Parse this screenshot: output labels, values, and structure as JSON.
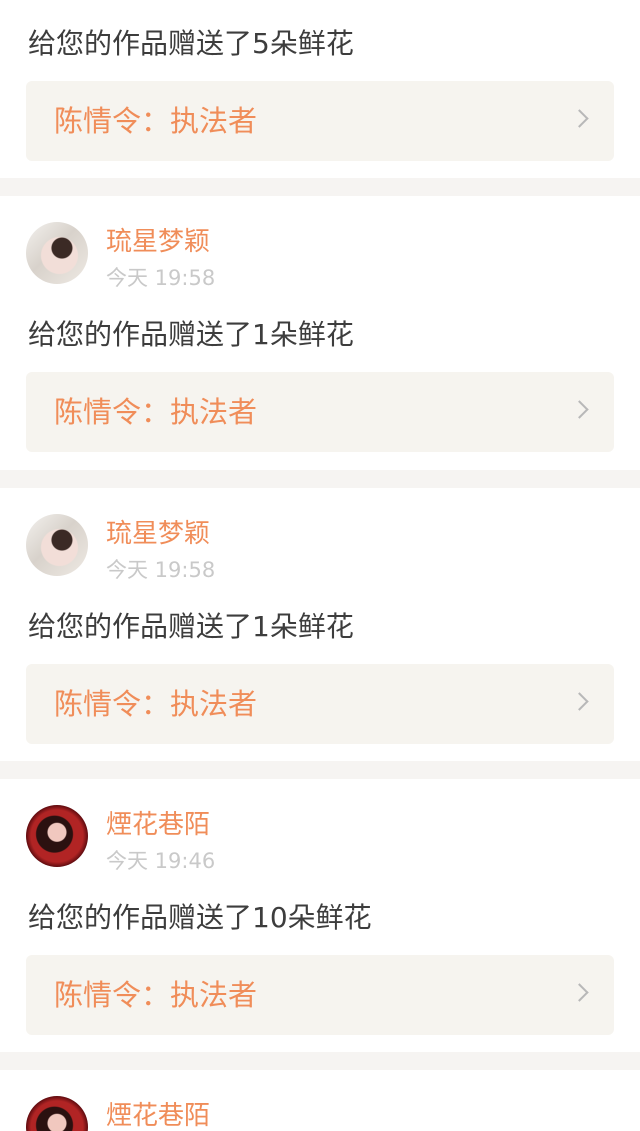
{
  "colors": {
    "accent": "#f08d59",
    "tab_indicator": "#e96a8f",
    "message_text": "#3d3d3d",
    "timestamp": "#c9c9c9",
    "card_link_bg": "#f6f4ef",
    "separator": "#f6f4f2"
  },
  "notifications": [
    {
      "username": "",
      "time": "",
      "message": "给您的作品赠送了5朵鲜花",
      "work_title": "陈情令：执法者",
      "chevron_icon": "chevron-right-icon"
    },
    {
      "username": "琉星梦颖",
      "time": "今天 19:58",
      "message": "给您的作品赠送了1朵鲜花",
      "work_title": "陈情令：执法者",
      "chevron_icon": "chevron-right-icon"
    },
    {
      "username": "琉星梦颖",
      "time": "今天 19:58",
      "message": "给您的作品赠送了1朵鲜花",
      "work_title": "陈情令：执法者",
      "chevron_icon": "chevron-right-icon"
    },
    {
      "username": "煙花巷陌",
      "time": "今天 19:46",
      "message": "给您的作品赠送了10朵鲜花",
      "work_title": "陈情令：执法者",
      "chevron_icon": "chevron-right-icon"
    },
    {
      "username": "煙花巷陌"
    }
  ]
}
